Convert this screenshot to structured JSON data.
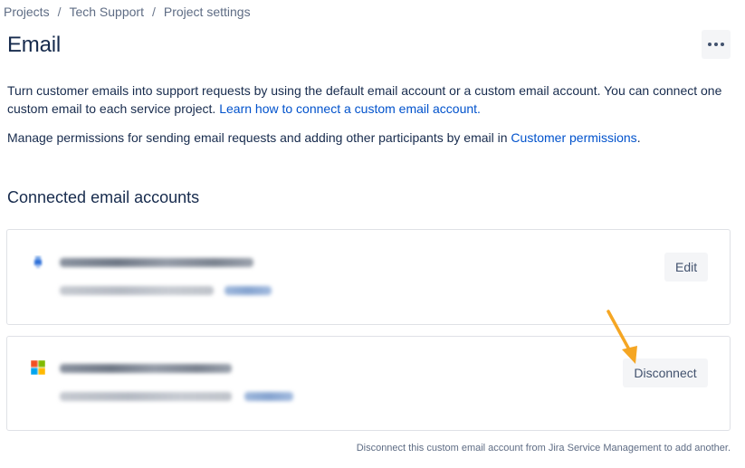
{
  "breadcrumbs": {
    "items": [
      "Projects",
      "Tech Support",
      "Project settings"
    ],
    "separator": "/"
  },
  "header": {
    "title": "Email",
    "more_actions_icon": "ellipsis-icon"
  },
  "intro": {
    "text": "Turn customer emails into support requests by using the default email account or a custom email account. You can connect one custom email to each service project. ",
    "link_label": "Learn how to connect a custom email account.",
    "permissions_text": "Manage permissions for sending email requests and adding other participants by email in ",
    "permissions_link": "Customer permissions",
    "permissions_suffix": "."
  },
  "connected": {
    "title": "Connected email accounts",
    "accounts": [
      {
        "provider_icon": "jira-default-email-icon",
        "address_obscured": true,
        "status_obscured": true,
        "action_label": "Edit"
      },
      {
        "provider_icon": "microsoft-icon",
        "address_obscured": true,
        "status_obscured": true,
        "action_label": "Disconnect"
      }
    ]
  },
  "footer": {
    "note": "Disconnect this custom email account from Jira Service Management to add another."
  },
  "colors": {
    "text": "#172b4d",
    "link": "#0052cc",
    "subtle": "#5e6c84",
    "button_bg": "#f4f5f7",
    "border": "#dfe1e6",
    "annotation_arrow": "#f5a623"
  }
}
